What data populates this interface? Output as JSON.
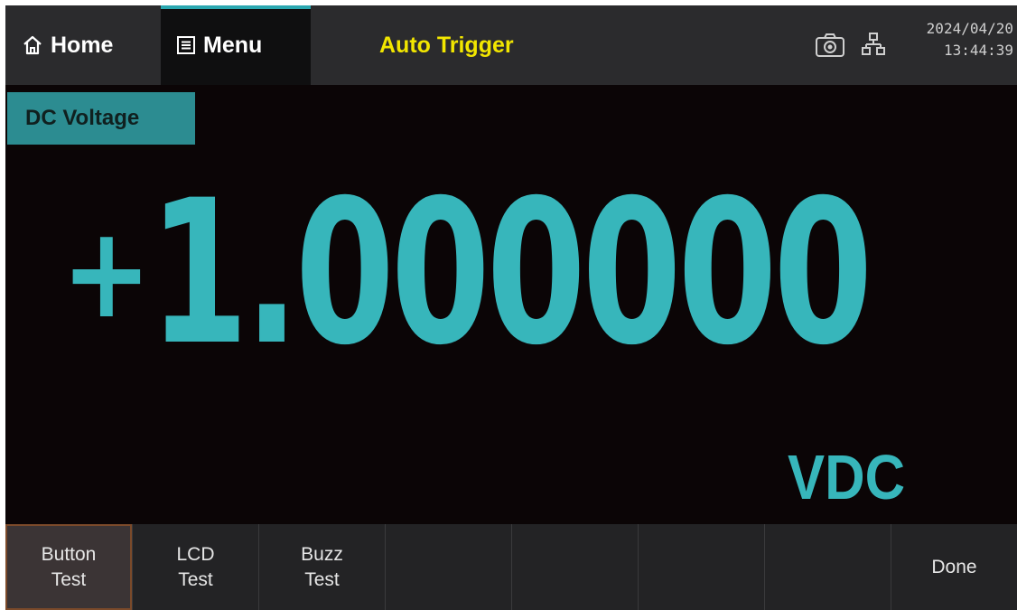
{
  "header": {
    "home_label": "Home",
    "menu_label": "Menu",
    "trigger_mode": "Auto Trigger",
    "date": "2024/04/20",
    "time": "13:44:39"
  },
  "measurement": {
    "function_label": "DC Voltage",
    "sign": "+",
    "value": "1.000000",
    "unit": "VDC"
  },
  "softkeys": [
    {
      "label": "Button\nTest",
      "selected": true
    },
    {
      "label": "LCD\nTest",
      "selected": false
    },
    {
      "label": "Buzz\nTest",
      "selected": false
    },
    {
      "label": "",
      "selected": false
    },
    {
      "label": "",
      "selected": false
    },
    {
      "label": "",
      "selected": false
    },
    {
      "label": "",
      "selected": false
    },
    {
      "label": "Done",
      "selected": false
    }
  ],
  "colors": {
    "accent": "#37b6bb",
    "trigger": "#f2e600",
    "background": "#0b0506",
    "function_badge": "#2c8c91"
  },
  "icons": {
    "home": "home-icon",
    "menu": "menu-icon",
    "screenshot": "camera-icon",
    "network": "network-icon"
  }
}
